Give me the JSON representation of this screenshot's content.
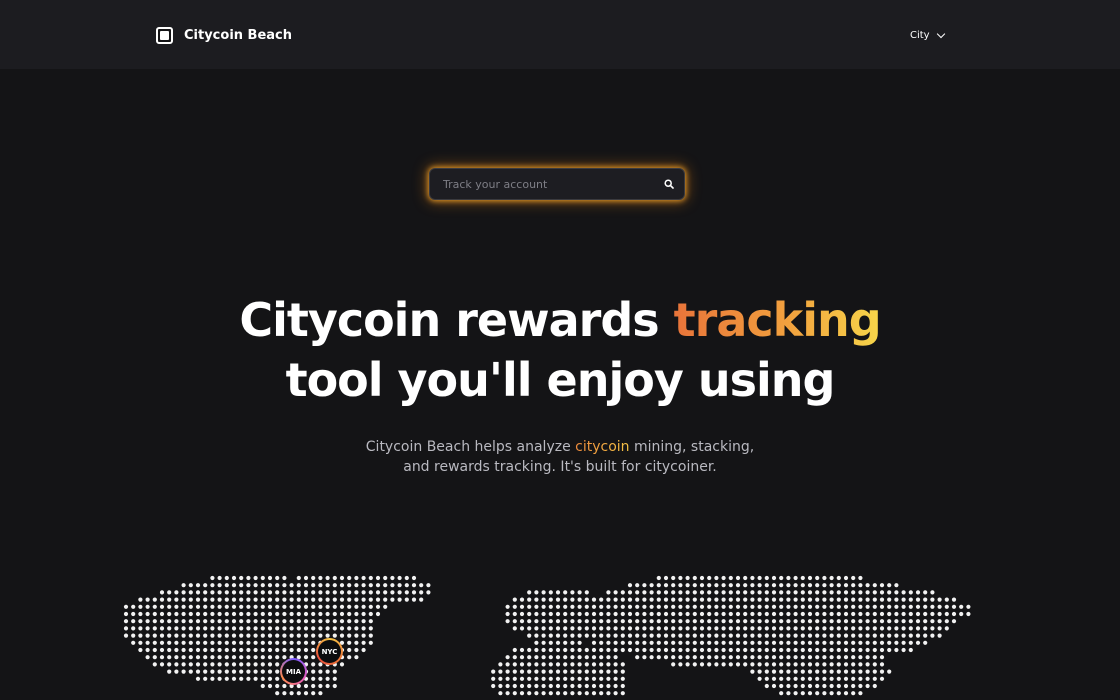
{
  "header": {
    "brand_name": "Citycoin Beach",
    "city_select_label": "City"
  },
  "search": {
    "placeholder": "Track your account",
    "value": ""
  },
  "hero": {
    "title_part1": "Citycoin rewards ",
    "title_highlight": "tracking",
    "title_part2": "tool you'll enjoy using",
    "subtitle_part1": "Citycoin Beach helps analyze ",
    "subtitle_highlight": "citycoin",
    "subtitle_part2": " mining, stacking,",
    "subtitle_part3": "and rewards tracking. It's built for citycoiner."
  },
  "map": {
    "markers": [
      {
        "label": "NYC"
      },
      {
        "label": "MIA"
      }
    ]
  },
  "colors": {
    "background": "#141416",
    "topbar": "#1c1c20",
    "accent_orange": "#e8743a",
    "accent_yellow": "#f7d64a",
    "search_glow": "#ffaa28"
  },
  "icons": [
    "brand-logo-icon",
    "chevron-down-icon",
    "search-icon"
  ]
}
